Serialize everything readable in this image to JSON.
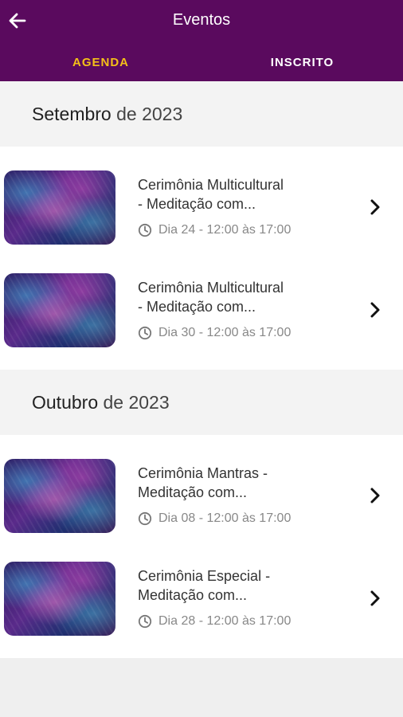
{
  "header": {
    "title": "Eventos",
    "tabs": [
      {
        "label": "AGENDA",
        "active": true
      },
      {
        "label": "INSCRITO",
        "active": false
      }
    ]
  },
  "colors": {
    "appbar": "#5a0a5e",
    "active_tab": "#f4c018"
  },
  "months": [
    {
      "name": "Setembro",
      "suffix": "de 2023",
      "events": [
        {
          "title_line1": "Cerimônia Multicultural",
          "title_line2": "- Meditação com...",
          "time": "Dia 24 - 12:00 às 17:00"
        },
        {
          "title_line1": "Cerimônia Multicultural",
          "title_line2": "- Meditação com...",
          "time": "Dia 30 - 12:00 às 17:00"
        }
      ]
    },
    {
      "name": "Outubro",
      "suffix": "de 2023",
      "events": [
        {
          "title_line1": "Cerimônia Mantras -",
          "title_line2": "Meditação com...",
          "time": "Dia 08 - 12:00 às 17:00"
        },
        {
          "title_line1": "Cerimônia Especial -",
          "title_line2": "Meditação com...",
          "time": "Dia 28 - 12:00 às 17:00"
        }
      ]
    }
  ]
}
